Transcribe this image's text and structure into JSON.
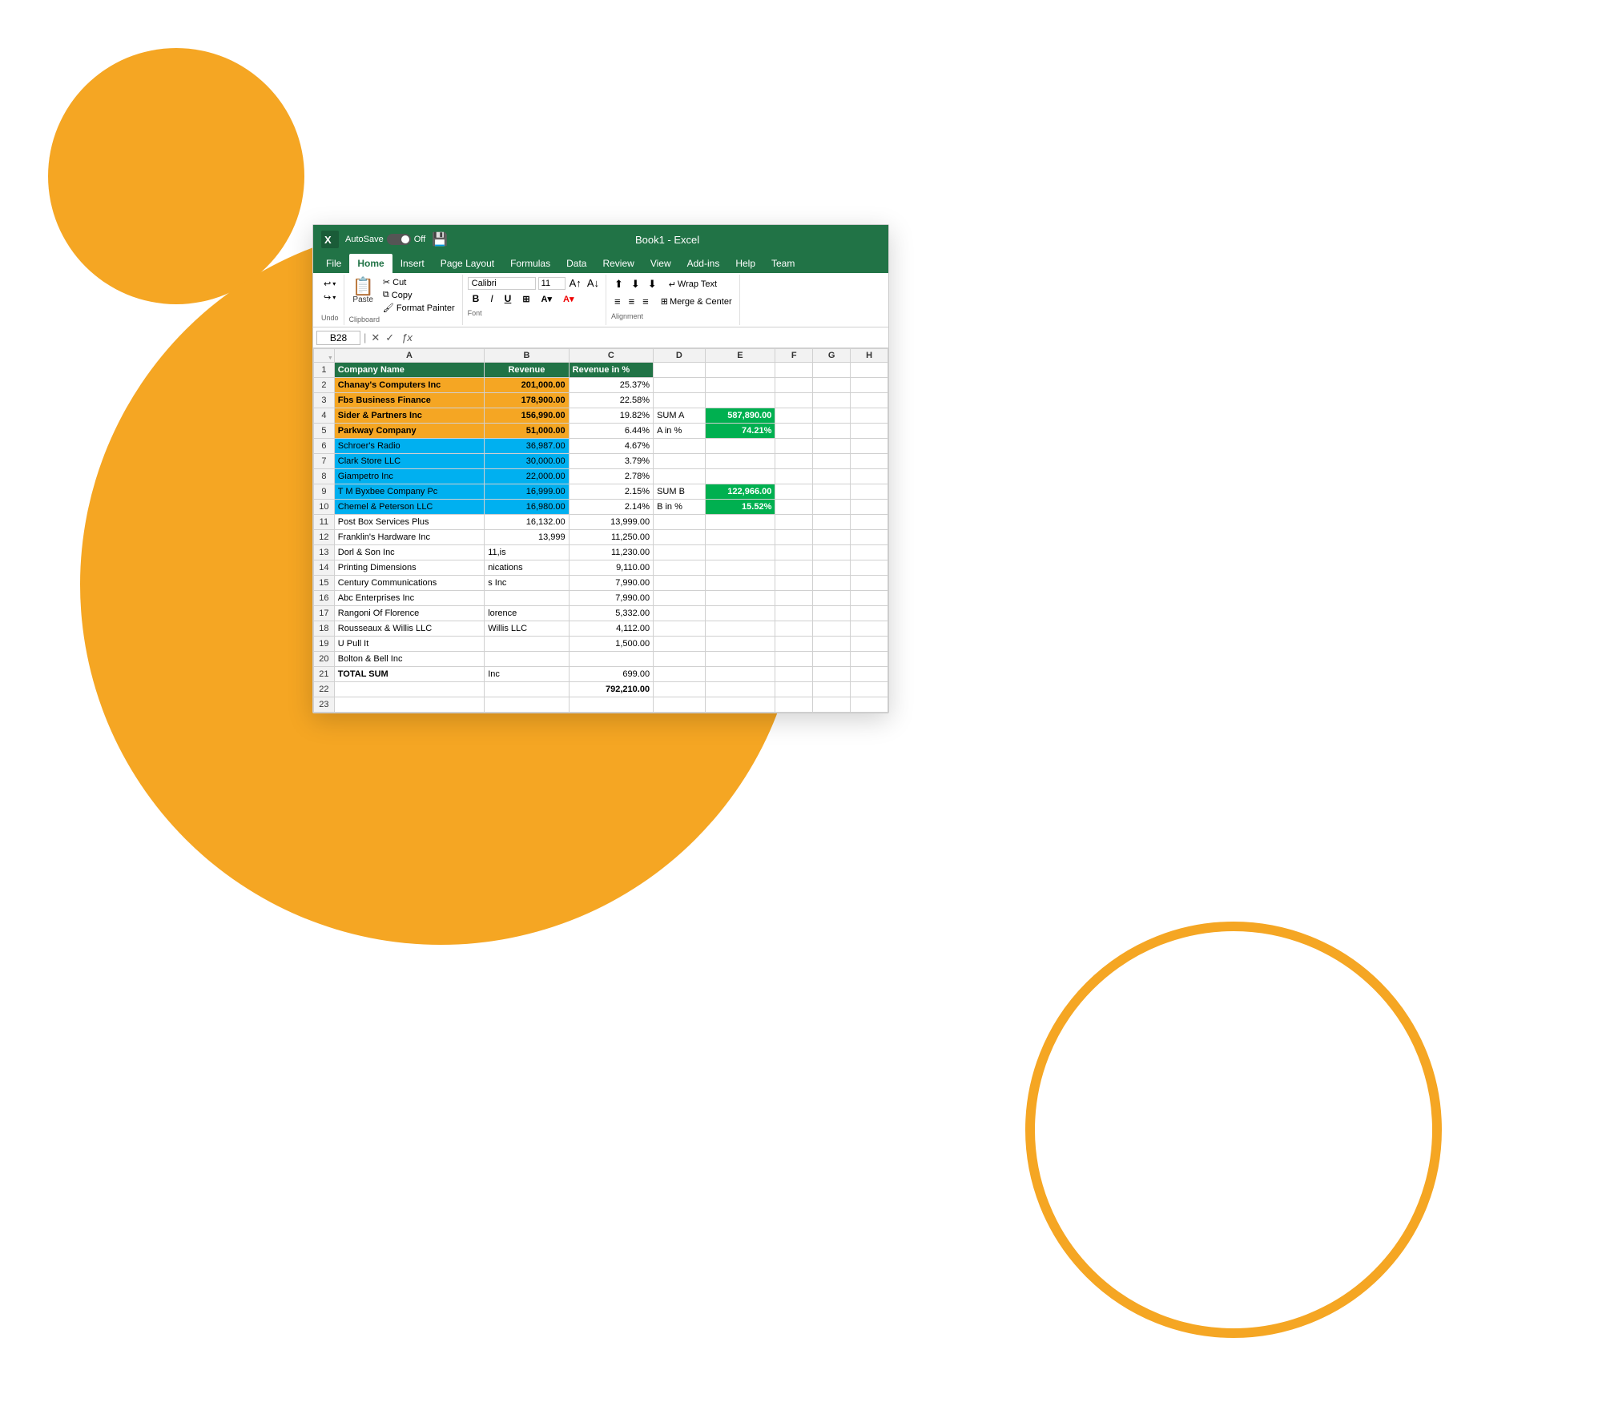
{
  "background": {
    "circle_large_color": "#F5A623",
    "circle_small_color": "#F5A623",
    "circle_outline_color": "#F5A623"
  },
  "titlebar": {
    "logo": "X",
    "autosave_label": "AutoSave",
    "toggle_state": "Off",
    "title": "Book1 - Excel",
    "save_icon": "💾"
  },
  "ribbon": {
    "tabs": [
      "File",
      "Home",
      "Insert",
      "Page Layout",
      "Formulas",
      "Data",
      "Review",
      "View",
      "Add-ins",
      "Help",
      "Team"
    ],
    "active_tab": "Home"
  },
  "toolbar": {
    "undo_label": "Undo",
    "undo_icon": "↩",
    "redo_icon": "↪",
    "paste_label": "Paste",
    "cut_label": "Cut",
    "copy_label": "Copy",
    "format_painter_label": "Format Painter",
    "clipboard_label": "Clipboard",
    "font_name": "Calibri",
    "font_size": "11",
    "bold": "B",
    "italic": "I",
    "underline": "U",
    "font_label": "Font",
    "wrap_text_label": "Wrap Text",
    "merge_center_label": "Merge & Center",
    "alignment_label": "Alignment"
  },
  "formula_bar": {
    "cell_ref": "B28",
    "fx": "ƒx"
  },
  "spreadsheet": {
    "col_headers": [
      "",
      "A",
      "B",
      "C",
      "D",
      "E",
      "F",
      "G",
      "H"
    ],
    "rows": [
      {
        "num": "1",
        "A": "Company Name",
        "B": "Revenue",
        "C": "Revenue in %",
        "D": "",
        "E": "",
        "F": "",
        "G": "",
        "H": ""
      },
      {
        "num": "2",
        "A": "Chanay's Computers Inc",
        "B": "201,000.00",
        "C": "25.37%",
        "D": "",
        "E": "",
        "F": "",
        "G": "",
        "H": "",
        "A_color": "orange",
        "B_color": "orange"
      },
      {
        "num": "3",
        "A": "Fbs Business Finance",
        "B": "178,900.00",
        "C": "22.58%",
        "D": "",
        "E": "",
        "F": "",
        "G": "",
        "H": "",
        "A_color": "orange",
        "B_color": "orange"
      },
      {
        "num": "4",
        "A": "Sider & Partners Inc",
        "B": "156,990.00",
        "C": "19.82%",
        "D": "SUM A",
        "E": "587,890.00",
        "F": "",
        "G": "",
        "H": "",
        "A_color": "orange",
        "B_color": "orange",
        "E_color": "excel_green"
      },
      {
        "num": "5",
        "A": "Parkway Company",
        "B": "51,000.00",
        "C": "6.44%",
        "D": "A in %",
        "E": "74.21%",
        "F": "",
        "G": "",
        "H": "",
        "A_color": "orange",
        "B_color": "orange",
        "E_color": "excel_green"
      },
      {
        "num": "6",
        "A": "Schroer's Radio",
        "B": "36,987.00",
        "C": "4.67%",
        "D": "",
        "E": "",
        "F": "",
        "G": "",
        "H": "",
        "A_color": "cyan",
        "B_color": "cyan"
      },
      {
        "num": "7",
        "A": "Clark Store LLC",
        "B": "30,000.00",
        "C": "3.79%",
        "D": "",
        "E": "",
        "F": "",
        "G": "",
        "H": "",
        "A_color": "cyan",
        "B_color": "cyan"
      },
      {
        "num": "8",
        "A": "Giampetro Inc",
        "B": "22,000.00",
        "C": "2.78%",
        "D": "",
        "E": "",
        "F": "",
        "G": "",
        "H": "",
        "A_color": "cyan",
        "B_color": "cyan"
      },
      {
        "num": "9",
        "A": "T M Byxbee Company Pc",
        "B": "16,999.00",
        "C": "2.15%",
        "D": "SUM B",
        "E": "122,966.00",
        "F": "",
        "G": "",
        "H": "",
        "A_color": "cyan",
        "B_color": "cyan",
        "E_color": "excel_green"
      },
      {
        "num": "10",
        "A": "Chemel & Peterson LLC",
        "B": "16,980.00",
        "C": "2.14%",
        "D": "B in %",
        "E": "15.52%",
        "F": "",
        "G": "",
        "H": "",
        "A_color": "cyan",
        "B_color": "cyan",
        "E_color": "excel_green"
      },
      {
        "num": "11",
        "A": "Post Box Services Plus",
        "B": "16,132.00",
        "C": "13,999.00",
        "D": "",
        "E": "",
        "F": "",
        "G": "",
        "H": ""
      },
      {
        "num": "12",
        "A": "Franklin's Hardware Inc",
        "B": "13,999",
        "C": "11,250.00",
        "D": "",
        "E": "",
        "F": "",
        "G": "",
        "H": ""
      },
      {
        "num": "13",
        "A": "Dorl & Son Inc",
        "B": "11,is",
        "C": "11,230.00",
        "D": "",
        "E": "",
        "F": "",
        "G": "",
        "H": ""
      },
      {
        "num": "14",
        "A": "Printing Dimensions",
        "B": "nications",
        "C": "9,110.00",
        "D": "",
        "E": "",
        "F": "",
        "G": "",
        "H": ""
      },
      {
        "num": "15",
        "A": "Century Communications",
        "B": "s Inc",
        "C": "7,990.00",
        "D": "",
        "E": "",
        "F": "",
        "G": "",
        "H": ""
      },
      {
        "num": "16",
        "A": "Abc Enterprises Inc",
        "B": "",
        "C": "7,990.00",
        "D": "",
        "E": "",
        "F": "",
        "G": "",
        "H": ""
      },
      {
        "num": "17",
        "A": "Rangoni Of Florence",
        "B": "lorence",
        "C": "5,332.00",
        "D": "",
        "E": "",
        "F": "",
        "G": "",
        "H": ""
      },
      {
        "num": "18",
        "A": "Rousseaux & Willis LLC",
        "B": "Willis LLC",
        "C": "4,112.00",
        "D": "",
        "E": "",
        "F": "",
        "G": "",
        "H": ""
      },
      {
        "num": "19",
        "A": "U Pull It",
        "B": "",
        "C": "1,500.00",
        "D": "",
        "E": "",
        "F": "",
        "G": "",
        "H": ""
      },
      {
        "num": "20",
        "A": "Bolton & Bell Inc",
        "B": "",
        "C": "",
        "D": "",
        "E": "",
        "F": "",
        "G": "",
        "H": ""
      },
      {
        "num": "21",
        "A": "TOTAL SUM",
        "B": "Inc",
        "C": "699.00",
        "D": "",
        "E": "",
        "F": "",
        "G": "",
        "H": "",
        "A_bold": true
      },
      {
        "num": "22",
        "A": "",
        "B": "",
        "C": "792,210.00",
        "D": "",
        "E": "",
        "F": "",
        "G": "",
        "H": "",
        "C_bold": true
      },
      {
        "num": "23",
        "A": "",
        "B": "",
        "C": "",
        "D": "",
        "E": "",
        "F": "",
        "G": "",
        "H": ""
      }
    ]
  }
}
